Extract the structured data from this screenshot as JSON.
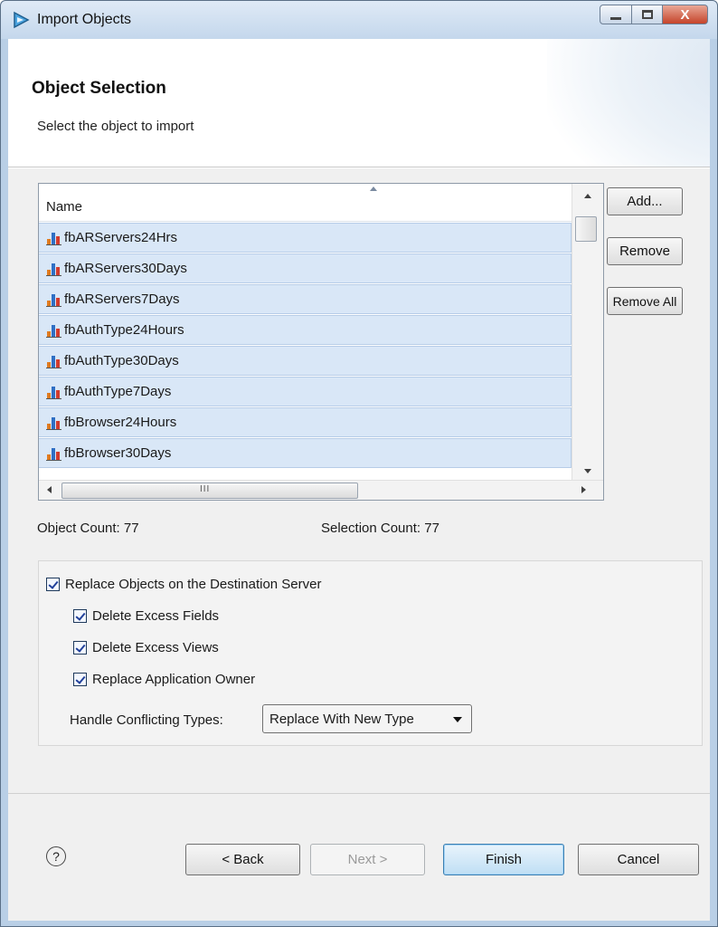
{
  "window": {
    "title": "Import Objects",
    "close_glyph": "X"
  },
  "header": {
    "title": "Object Selection",
    "subtitle": "Select the object to import"
  },
  "table": {
    "column_header": "Name",
    "rows": [
      "fbARServers24Hrs",
      "fbARServers30Days",
      "fbARServers7Days",
      "fbAuthType24Hours",
      "fbAuthType30Days",
      "fbAuthType7Days",
      "fbBrowser24Hours",
      "fbBrowser30Days"
    ],
    "hscroll_grip": "III"
  },
  "side_buttons": {
    "add": "Add...",
    "remove": "Remove",
    "remove_all": "Remove All"
  },
  "counts": {
    "object": "Object Count: 77",
    "selection": "Selection Count: 77"
  },
  "options": {
    "replace_objects": {
      "label": "Replace Objects on the Destination Server",
      "checked": true
    },
    "delete_excess_fields": {
      "label": "Delete Excess Fields",
      "checked": true
    },
    "delete_excess_views": {
      "label": "Delete Excess Views",
      "checked": true
    },
    "replace_app_owner": {
      "label": "Replace Application Owner",
      "checked": true
    },
    "handle_conflicting_label": "Handle Conflicting Types:",
    "handle_conflicting_value": "Replace With New Type"
  },
  "footer": {
    "help": "?",
    "back": "< Back",
    "next": "Next >",
    "finish": "Finish",
    "cancel": "Cancel"
  },
  "colors": {
    "row_selected": "#d9e7f7",
    "finish_border": "#3c7fb1",
    "title_bar": "#c4d7ec"
  }
}
